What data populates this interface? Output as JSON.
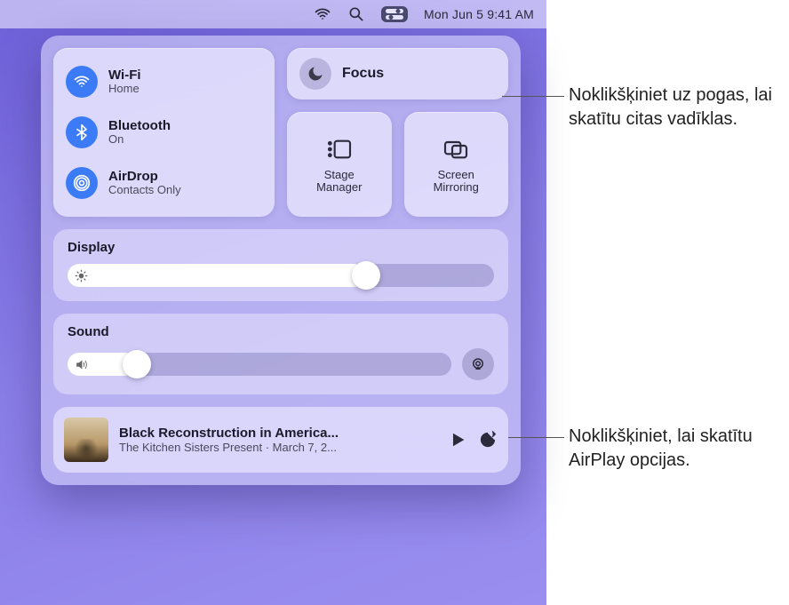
{
  "menubar": {
    "datetime": "Mon Jun 5  9:41 AM"
  },
  "connectivity": {
    "wifi": {
      "title": "Wi-Fi",
      "sub": "Home"
    },
    "bluetooth": {
      "title": "Bluetooth",
      "sub": "On"
    },
    "airdrop": {
      "title": "AirDrop",
      "sub": "Contacts Only"
    }
  },
  "focus": {
    "label": "Focus"
  },
  "tiles": {
    "stage": "Stage\nManager",
    "mirror": "Screen\nMirroring"
  },
  "display": {
    "label": "Display",
    "value_pct": 70
  },
  "sound": {
    "label": "Sound",
    "value_pct": 18
  },
  "now_playing": {
    "title": "Black Reconstruction in America...",
    "sub": "The Kitchen Sisters Present · March 7, 2..."
  },
  "callouts": {
    "focus": "Noklikšķiniet uz pogas, lai skatītu citas vadīklas.",
    "airplay": "Noklikšķiniet, lai skatītu AirPlay opcijas."
  }
}
